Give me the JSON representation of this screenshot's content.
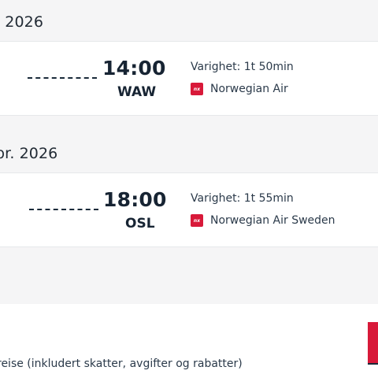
{
  "flights": [
    {
      "date_header": ". 2026",
      "arrival_time": "14:00",
      "arrival_airport": "WAW",
      "duration": "Varighet: 1t 50min",
      "airline": "Norwegian Air",
      "airline_logo_text": "nx"
    },
    {
      "date_header": "pr. 2026",
      "arrival_time": "18:00",
      "arrival_airport": "OSL",
      "duration": "Varighet: 1t 55min",
      "airline": "Norwegian Air Sweden",
      "airline_logo_text": "nx"
    }
  ],
  "price_note": "reise (inkludert skatter, avgifter og rabatter)",
  "colors": {
    "brand_red": "#d81939",
    "background": "#f5f5f6",
    "text_dark": "#172433"
  }
}
